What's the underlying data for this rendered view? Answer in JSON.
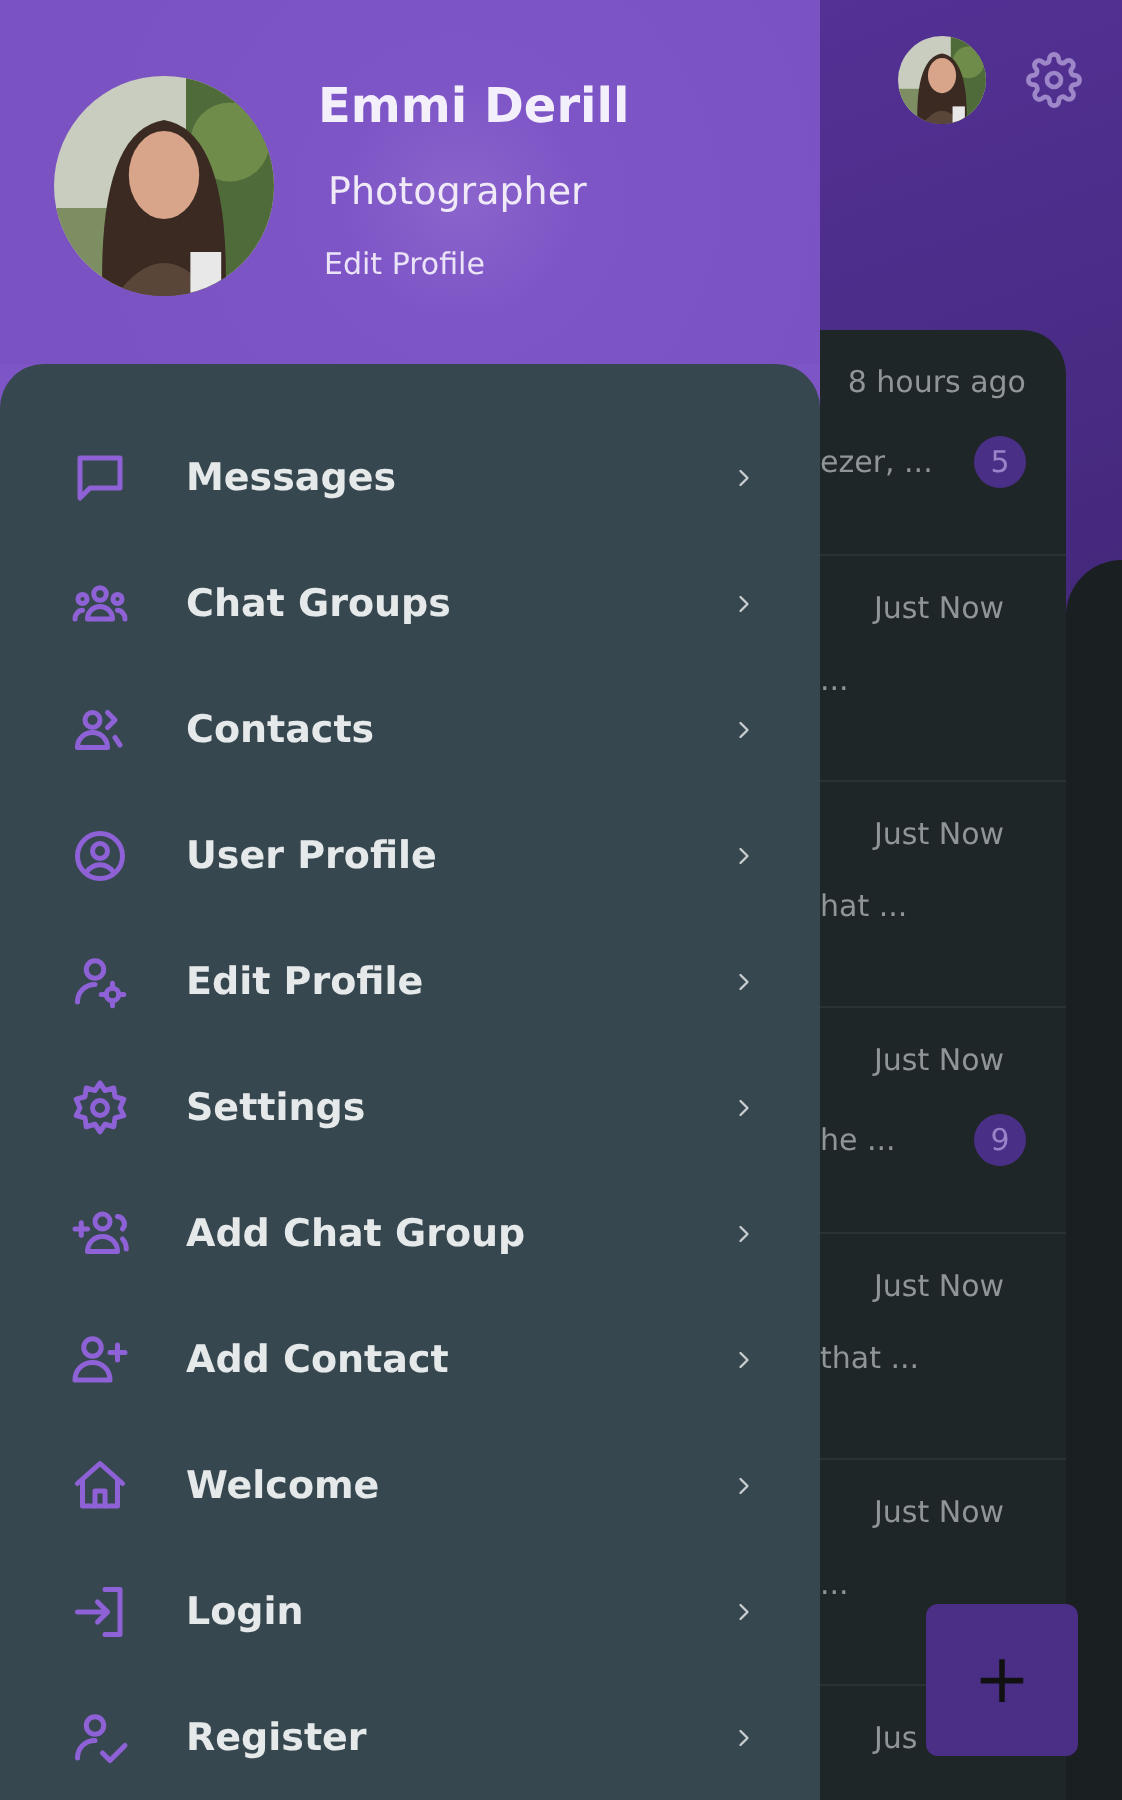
{
  "drawer": {
    "profile": {
      "name": "Emmi Derill",
      "role": "Photographer",
      "link": "Edit Profile"
    },
    "menu": [
      "Messages",
      "Chat Groups",
      "Contacts",
      "User Profile",
      "Edit Profile",
      "Settings",
      "Add Chat Group",
      "Add Contact",
      "Welcome",
      "Login",
      "Register"
    ]
  },
  "chat_list": {
    "rows": [
      {
        "time": "8 hours ago",
        "preview": "ezer, ...",
        "badge": "5"
      },
      {
        "time": "Just Now",
        "preview": "..."
      },
      {
        "time": "Just Now",
        "preview": "hat ..."
      },
      {
        "time": "Just Now",
        "preview": "he ...",
        "badge": "9"
      },
      {
        "time": "Just Now",
        "preview": "that ..."
      },
      {
        "time": "Just Now",
        "preview": "..."
      },
      {
        "time": "Jus"
      }
    ]
  },
  "fab": {
    "label": "+"
  }
}
